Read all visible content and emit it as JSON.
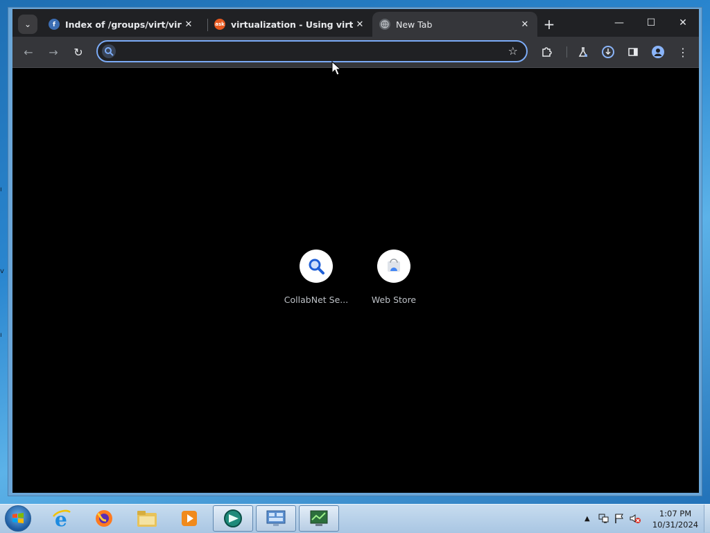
{
  "browser": {
    "tabs": [
      {
        "title": "Index of /groups/virt/virtio-wi",
        "favicon": "fedora-icon",
        "active": false
      },
      {
        "title": "virtualization - Using virtio-wi",
        "favicon": "ask-icon",
        "favicon_text": "ask",
        "active": false
      },
      {
        "title": "New Tab",
        "favicon": "globe-icon",
        "active": true
      }
    ],
    "new_tab_symbol": "+",
    "window_controls": {
      "minimize": "—",
      "maximize": "☐",
      "close": "✕"
    },
    "omnibox": {
      "value": "",
      "placeholder": ""
    },
    "accent_color": "#7cacf8"
  },
  "newtab_page": {
    "shortcuts": [
      {
        "label": "CollabNet Se...",
        "icon": "search-icon"
      },
      {
        "label": "Web Store",
        "icon": "webstore-icon"
      }
    ]
  },
  "taskbar": {
    "pinned": [
      "internet-explorer-icon",
      "firefox-icon",
      "file-explorer-icon",
      "media-player-icon",
      "app-teal-icon",
      "control-panel-icon",
      "network-monitor-icon"
    ],
    "clock": {
      "time": "1:07 PM",
      "date": "10/31/2024"
    }
  }
}
